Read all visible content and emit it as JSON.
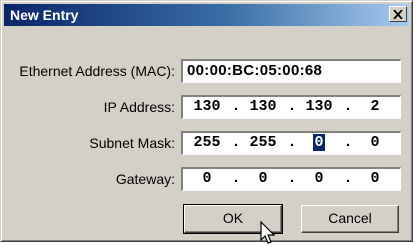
{
  "window": {
    "title": "New Entry",
    "close_glyph": "✕"
  },
  "fields": {
    "mac": {
      "label": "Ethernet Address (MAC):",
      "value": "00:00:BC:05:00:68"
    },
    "ip": {
      "label": "IP Address:",
      "octets": [
        "130",
        "130",
        "130",
        "2"
      ]
    },
    "subnet": {
      "label": "Subnet Mask:",
      "octets": [
        "255",
        "255",
        "0",
        "0"
      ],
      "selected_octet": 3
    },
    "gateway": {
      "label": "Gateway:",
      "octets": [
        "0",
        "0",
        "0",
        "0"
      ]
    }
  },
  "buttons": {
    "ok": "OK",
    "cancel": "Cancel"
  },
  "icons": {
    "close": "close-icon",
    "cursor": "mouse-pointer-icon"
  },
  "colors": {
    "title_bar": "#0a246a",
    "selection": "#0a246a",
    "face": "#d4d0c8"
  }
}
